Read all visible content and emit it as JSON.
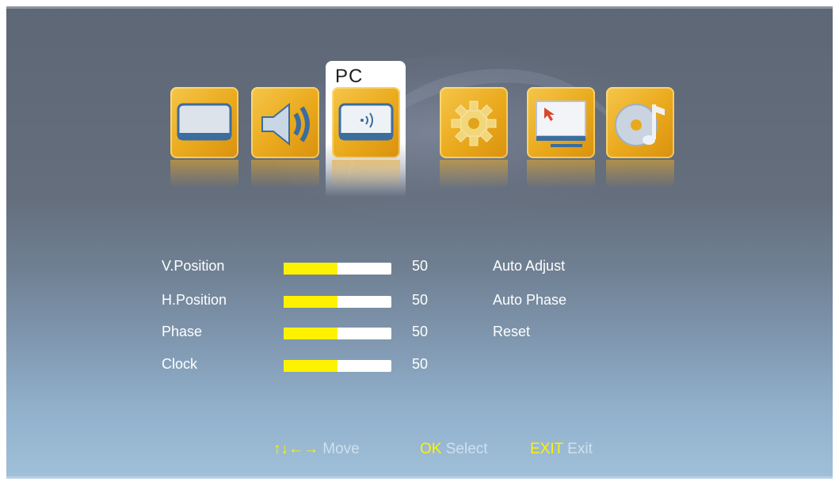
{
  "menu": {
    "tabs": [
      {
        "icon": "picture-monitor-icon",
        "label": ""
      },
      {
        "icon": "sound-speaker-icon",
        "label": ""
      },
      {
        "icon": "pc-monitor-icon",
        "label": "PC",
        "selected": true
      },
      {
        "icon": "gear-icon",
        "label": ""
      },
      {
        "icon": "pointer-screen-icon",
        "label": ""
      },
      {
        "icon": "media-disc-music-icon",
        "label": ""
      }
    ],
    "active_title": "PC"
  },
  "settings": [
    {
      "label": "V.Position",
      "value": "50",
      "level": 0.5
    },
    {
      "label": "H.Position",
      "value": "50",
      "level": 0.5
    },
    {
      "label": "Phase",
      "value": "50",
      "level": 0.5
    },
    {
      "label": "Clock",
      "value": "50",
      "level": 0.5
    }
  ],
  "actions": [
    "Auto Adjust",
    "Auto Phase",
    "Reset"
  ],
  "footer": {
    "move_key": "↑↓←→",
    "move_label": "Move",
    "ok_key": "OK",
    "ok_label": "Select",
    "exit_key": "EXIT",
    "exit_label": "Exit"
  },
  "colors": {
    "accent_yellow": "#fff200",
    "tile_orange": "#eaa91c"
  }
}
